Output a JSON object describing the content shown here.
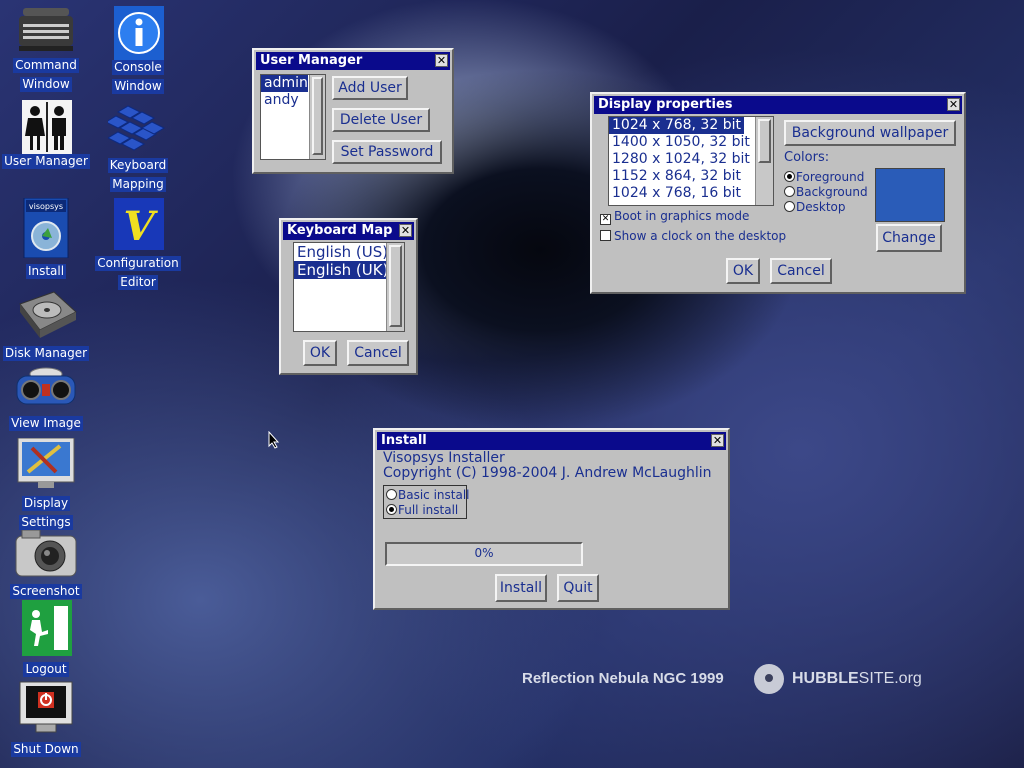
{
  "desktop": {
    "icons": [
      {
        "label_lines": [
          "Command",
          "Window"
        ]
      },
      {
        "label_lines": [
          "Console",
          "Window"
        ]
      },
      {
        "label_lines": [
          "User Manager"
        ]
      },
      {
        "label_lines": [
          "Keyboard",
          "Mapping"
        ]
      },
      {
        "label_lines": [
          "Install"
        ]
      },
      {
        "label_lines": [
          "Configuration",
          "Editor"
        ]
      },
      {
        "label_lines": [
          "Disk Manager"
        ]
      },
      {
        "label_lines": [
          "View Image"
        ]
      },
      {
        "label_lines": [
          "Display",
          "Settings"
        ]
      },
      {
        "label_lines": [
          "Screenshot"
        ]
      },
      {
        "label_lines": [
          "Logout"
        ]
      },
      {
        "label_lines": [
          "Shut Down"
        ]
      }
    ],
    "icon_box_text": "visopsys",
    "config_letter": "V",
    "wallpaper_caption": "Reflection Nebula NGC 1999",
    "hubble_bold": "HUBBLE",
    "hubble_rest": "SITE.org"
  },
  "user_manager": {
    "title": "User Manager",
    "users": [
      "admin",
      "andy"
    ],
    "selected_user": "admin",
    "buttons": {
      "add": "Add User",
      "delete": "Delete User",
      "password": "Set Password"
    }
  },
  "keyboard_map": {
    "title": "Keyboard Map",
    "layouts": [
      "English (US)",
      "English (UK)"
    ],
    "buttons": {
      "ok": "OK",
      "cancel": "Cancel"
    }
  },
  "display_properties": {
    "title": "Display properties",
    "modes": [
      "1024 x 768, 32 bit",
      "1400 x 1050, 32 bit",
      "1280 x 1024, 32 bit",
      "1152 x 864, 32 bit",
      "1024 x 768, 16 bit"
    ],
    "selected_mode": "1024 x 768, 32 bit",
    "wallpaper_button": "Background wallpaper",
    "colors_label": "Colors:",
    "color_options": [
      "Foreground",
      "Background",
      "Desktop"
    ],
    "selected_color_option": "Foreground",
    "swatch_color": "#2a5cb8",
    "change_button": "Change",
    "boot_graphics_label": "Boot in graphics mode",
    "boot_graphics_checked": true,
    "clock_label": "Show a clock on the desktop",
    "clock_checked": false,
    "buttons": {
      "ok": "OK",
      "cancel": "Cancel"
    }
  },
  "installer": {
    "title": "Install",
    "heading": "Visopsys Installer",
    "copyright": "Copyright (C) 1998-2004 J. Andrew McLaughlin",
    "options": [
      "Basic install",
      "Full install"
    ],
    "selected_option": "Full install",
    "progress_percent": 0,
    "progress_text": "0%",
    "buttons": {
      "install": "Install",
      "quit": "Quit"
    }
  },
  "colors": {
    "titlebar": "#0a0a8c",
    "window_bg": "#c0c0c0",
    "text_blue": "#1a2f90",
    "icon_label_bg": "#1a3aa0"
  }
}
